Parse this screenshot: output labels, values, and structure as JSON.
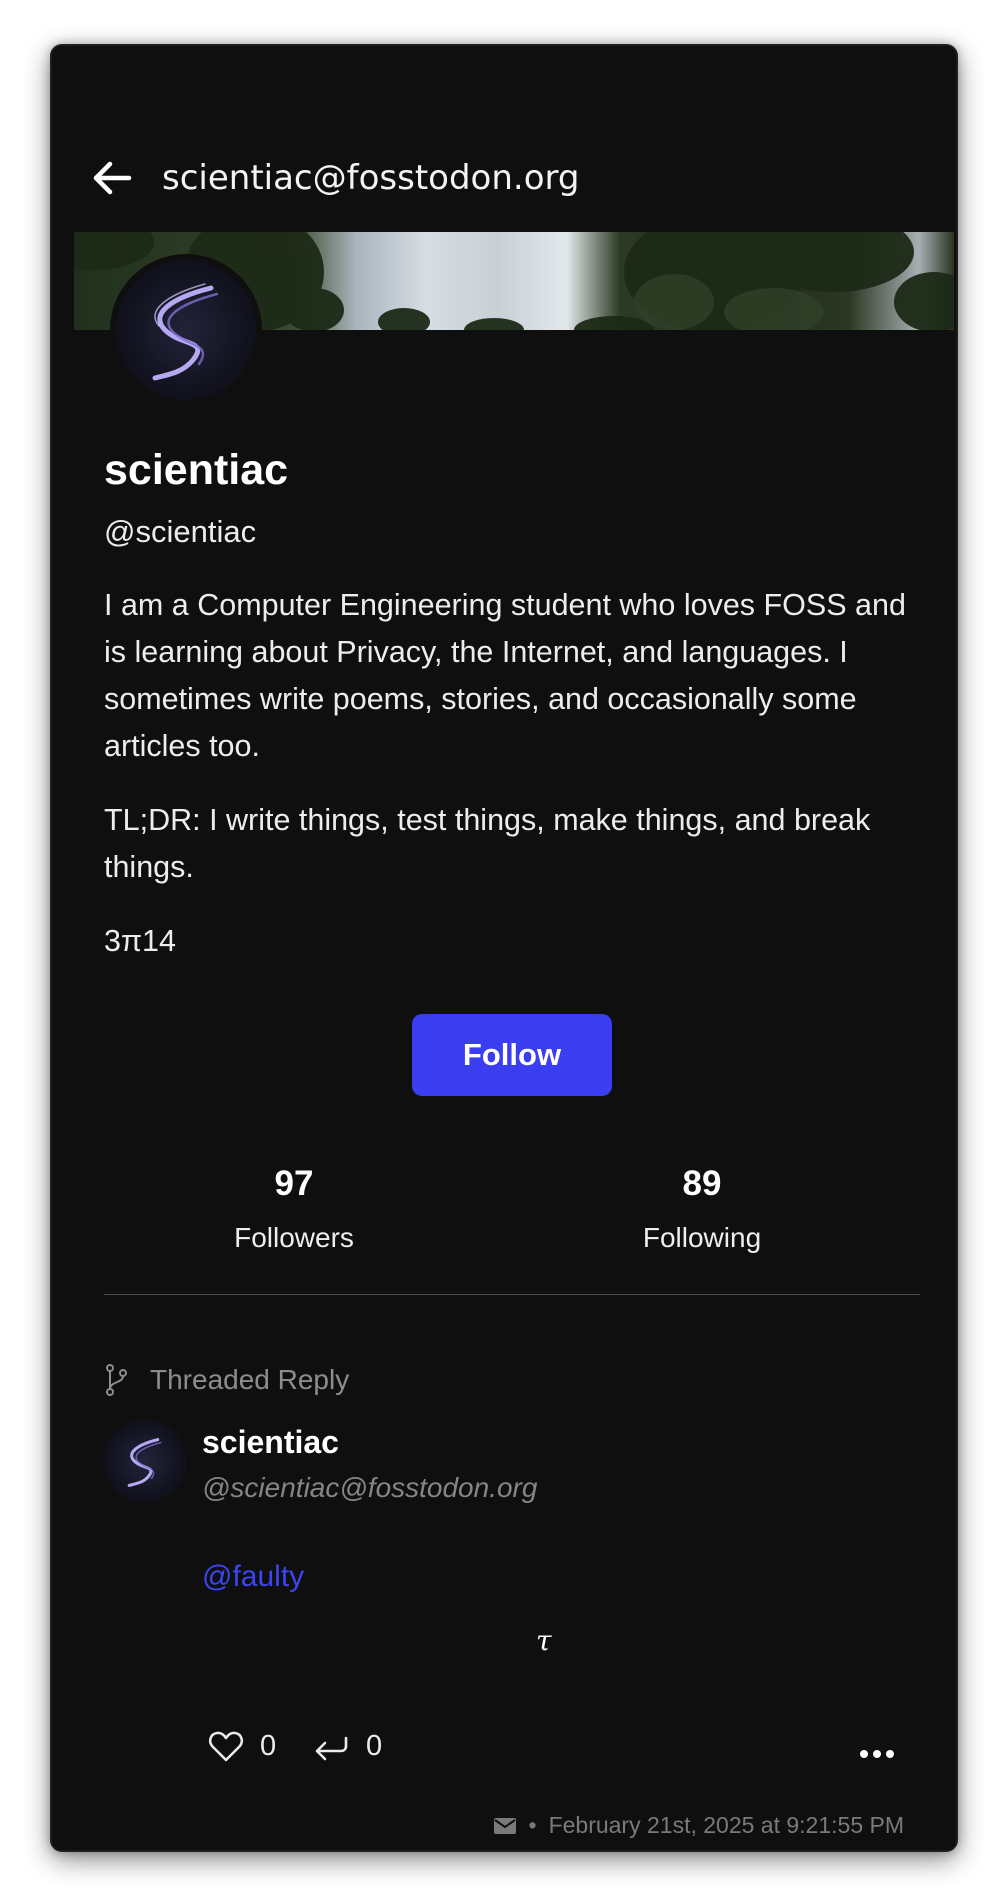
{
  "header": {
    "title": "scientiac@fosstodon.org",
    "back_icon": "arrow-left-icon"
  },
  "profile": {
    "display_name": "scientiac",
    "handle": "@scientiac",
    "bio": [
      "I am a Computer Engineering student who loves FOSS and is learning about Privacy, the Internet, and languages. I sometimes write poems, stories, and occasionally some articles too.",
      "TL;DR: I write things, test things, make things, and break things.",
      "3π14"
    ],
    "follow_label": "Follow",
    "followers_count": "97",
    "followers_label": "Followers",
    "following_count": "89",
    "following_label": "Following"
  },
  "post": {
    "thread_label": "Threaded Reply",
    "author_name": "scientiac",
    "author_handle": "@scientiac@fosstodon.org",
    "mention": "@faulty",
    "content": "τ",
    "like_count": "0",
    "reply_count": "0",
    "visibility_icon": "mail-icon",
    "separator": "•",
    "timestamp": "February 21st, 2025 at 9:21:55 PM"
  },
  "colors": {
    "background": "#0f0f0f",
    "accent": "#3a3df0",
    "mention": "#3c45f2",
    "muted": "#858585"
  }
}
